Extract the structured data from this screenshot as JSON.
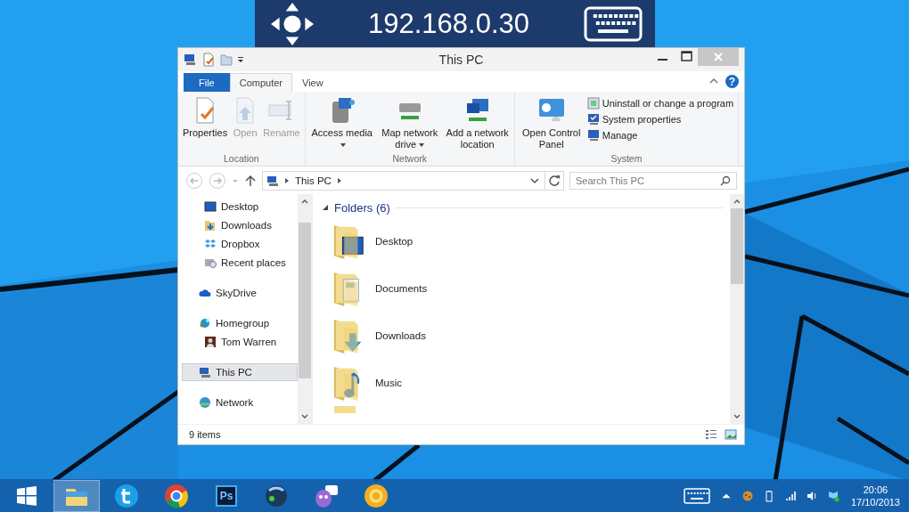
{
  "remote_bar": {
    "address": "192.168.0.30"
  },
  "window": {
    "title": "This PC",
    "ribbon_tabs": [
      {
        "label": "File",
        "kind": "file",
        "selected": false
      },
      {
        "label": "Computer",
        "kind": "tab",
        "selected": true
      },
      {
        "label": "View",
        "kind": "tab",
        "selected": false
      }
    ],
    "help": "?",
    "ribbon_groups": [
      {
        "name": "Location",
        "items": [
          {
            "label": "Properties",
            "kind": "properties",
            "disabled": false,
            "dropdown": false
          },
          {
            "label": "Open",
            "kind": "open",
            "disabled": true,
            "dropdown": false
          },
          {
            "label": "Rename",
            "kind": "rename",
            "disabled": true,
            "dropdown": false
          }
        ]
      },
      {
        "name": "Network",
        "items": [
          {
            "label": "Access media",
            "kind": "media",
            "disabled": false,
            "dropdown": true
          },
          {
            "label": "Map network drive",
            "kind": "drive",
            "disabled": false,
            "dropdown": true
          },
          {
            "label": "Add a network location",
            "kind": "netloc",
            "disabled": false,
            "dropdown": false
          }
        ]
      },
      {
        "name": "System",
        "items": [
          {
            "label": "Open Control Panel",
            "kind": "control",
            "disabled": false,
            "dropdown": false
          }
        ],
        "links": [
          {
            "label": "Uninstall or change a program",
            "kind": "uninstall"
          },
          {
            "label": "System properties",
            "kind": "sysprops"
          },
          {
            "label": "Manage",
            "kind": "manage"
          }
        ]
      }
    ],
    "address": {
      "path": "This PC"
    },
    "search": {
      "placeholder": "Search This PC"
    },
    "nav": [
      {
        "children": [
          {
            "label": "Desktop",
            "kind": "desktop",
            "selected": false
          },
          {
            "label": "Downloads",
            "kind": "downloads",
            "selected": false
          },
          {
            "label": "Dropbox",
            "kind": "dropbox",
            "selected": false
          },
          {
            "label": "Recent places",
            "kind": "recent",
            "selected": false
          }
        ]
      },
      {
        "label": "SkyDrive",
        "kind": "cloud",
        "selected": false
      },
      {
        "label": "Homegroup",
        "kind": "homegroup",
        "selected": false,
        "children": [
          {
            "label": "Tom Warren",
            "kind": "avatar",
            "selected": false
          }
        ]
      },
      {
        "label": "This PC",
        "kind": "pc",
        "selected": true
      },
      {
        "label": "Network",
        "kind": "network",
        "selected": false
      }
    ],
    "group": {
      "title": "Folders (6)",
      "expanded": true
    },
    "folders": [
      {
        "name": "Desktop",
        "kind": "desktop"
      },
      {
        "name": "Documents",
        "kind": "documents"
      },
      {
        "name": "Downloads",
        "kind": "downloads"
      },
      {
        "name": "Music",
        "kind": "music"
      }
    ],
    "status": "9 items"
  },
  "taskbar": {
    "apps": [
      {
        "kind": "start",
        "selected": false
      },
      {
        "kind": "explorer",
        "selected": true
      },
      {
        "kind": "twitter",
        "selected": false
      },
      {
        "kind": "chrome",
        "selected": false
      },
      {
        "kind": "photoshop",
        "selected": false,
        "label": "Ps"
      },
      {
        "kind": "steam",
        "selected": false
      },
      {
        "kind": "chat",
        "selected": false
      },
      {
        "kind": "yellow",
        "selected": false
      }
    ],
    "time": "20:06",
    "date": "17/10/2013"
  }
}
